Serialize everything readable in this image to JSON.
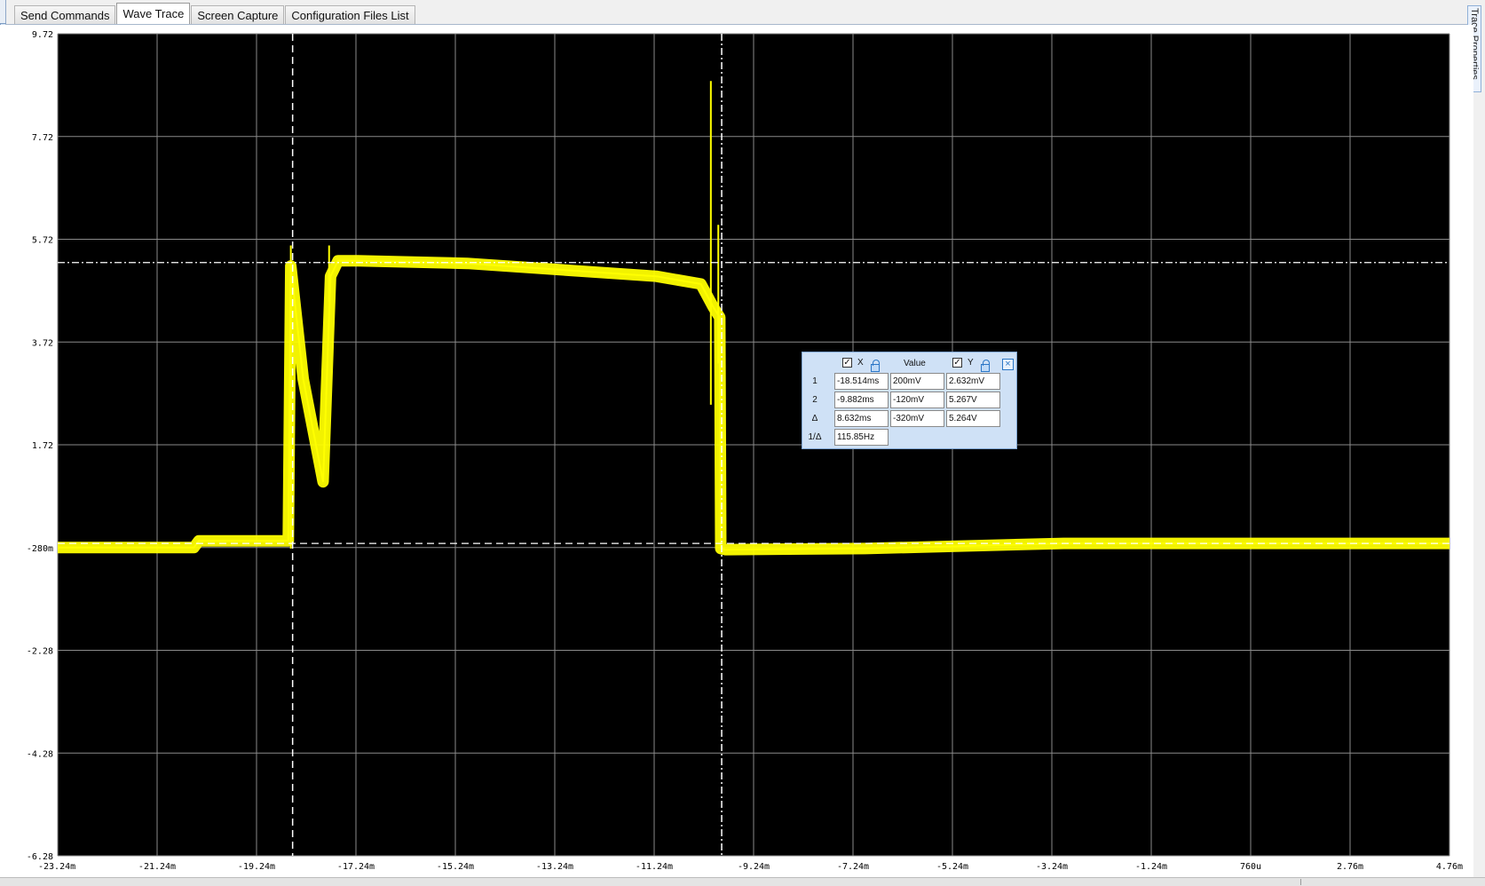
{
  "tabs": [
    {
      "label": "Send Commands",
      "active": false
    },
    {
      "label": "Wave Trace",
      "active": true
    },
    {
      "label": "Screen Capture",
      "active": false
    },
    {
      "label": "Configuration Files List",
      "active": false
    }
  ],
  "side_tab": {
    "label": "Trace Properties"
  },
  "colors": {
    "trace": "#ffff00",
    "grid": "#8a8a8a",
    "background": "#000000",
    "cursor": "#ffffff"
  },
  "chart_data": {
    "type": "line",
    "title": "",
    "xlabel": "",
    "ylabel": "",
    "x_ticks": [
      "-23.24m",
      "-21.24m",
      "-19.24m",
      "-17.24m",
      "-15.24m",
      "-13.24m",
      "-11.24m",
      "-9.24m",
      "-7.24m",
      "-5.24m",
      "-3.24m",
      "-1.24m",
      "760u",
      "2.76m",
      "4.76m"
    ],
    "y_ticks": [
      "9.72",
      "7.72",
      "5.72",
      "3.72",
      "1.72",
      "-280m",
      "-2.28",
      "-4.28",
      "-6.28"
    ],
    "xlim": [
      -0.02324,
      0.00476
    ],
    "ylim": [
      -6.28,
      9.72
    ],
    "grid": true,
    "series": [
      {
        "color": "#ffff00",
        "x_ms": [
          -23.24,
          -20.5,
          -20.4,
          -18.6,
          -18.55,
          -18.3,
          -17.9,
          -17.75,
          -17.6,
          -17.2,
          -15.0,
          -11.2,
          -10.3,
          -10.05,
          -9.92,
          -9.9,
          -9.8,
          -7.0,
          -3.0,
          0.0,
          4.76
        ],
        "y_v": [
          -0.28,
          -0.28,
          -0.15,
          -0.15,
          5.2,
          3.0,
          1.0,
          5.0,
          5.3,
          5.3,
          5.25,
          5.0,
          4.85,
          4.4,
          4.2,
          -0.3,
          -0.32,
          -0.3,
          -0.2,
          -0.2,
          -0.2
        ]
      }
    ],
    "cursors": {
      "x1_ms": -18.514,
      "x2_ms": -9.882,
      "y1_v": -0.2,
      "y2_v": 5.267
    }
  },
  "cursor_window": {
    "headers": {
      "x": "X",
      "value": "Value",
      "y": "Y"
    },
    "x_checked": true,
    "y_checked": true,
    "rows": [
      {
        "label": "1",
        "x": "-18.514ms",
        "value": "200mV",
        "y": "2.632mV"
      },
      {
        "label": "2",
        "x": "-9.882ms",
        "value": "-120mV",
        "y": "5.267V"
      },
      {
        "label": "Δ",
        "x": "8.632ms",
        "value": "-320mV",
        "y": "5.264V"
      },
      {
        "label": "1/Δ",
        "x": "115.85Hz"
      }
    ]
  }
}
